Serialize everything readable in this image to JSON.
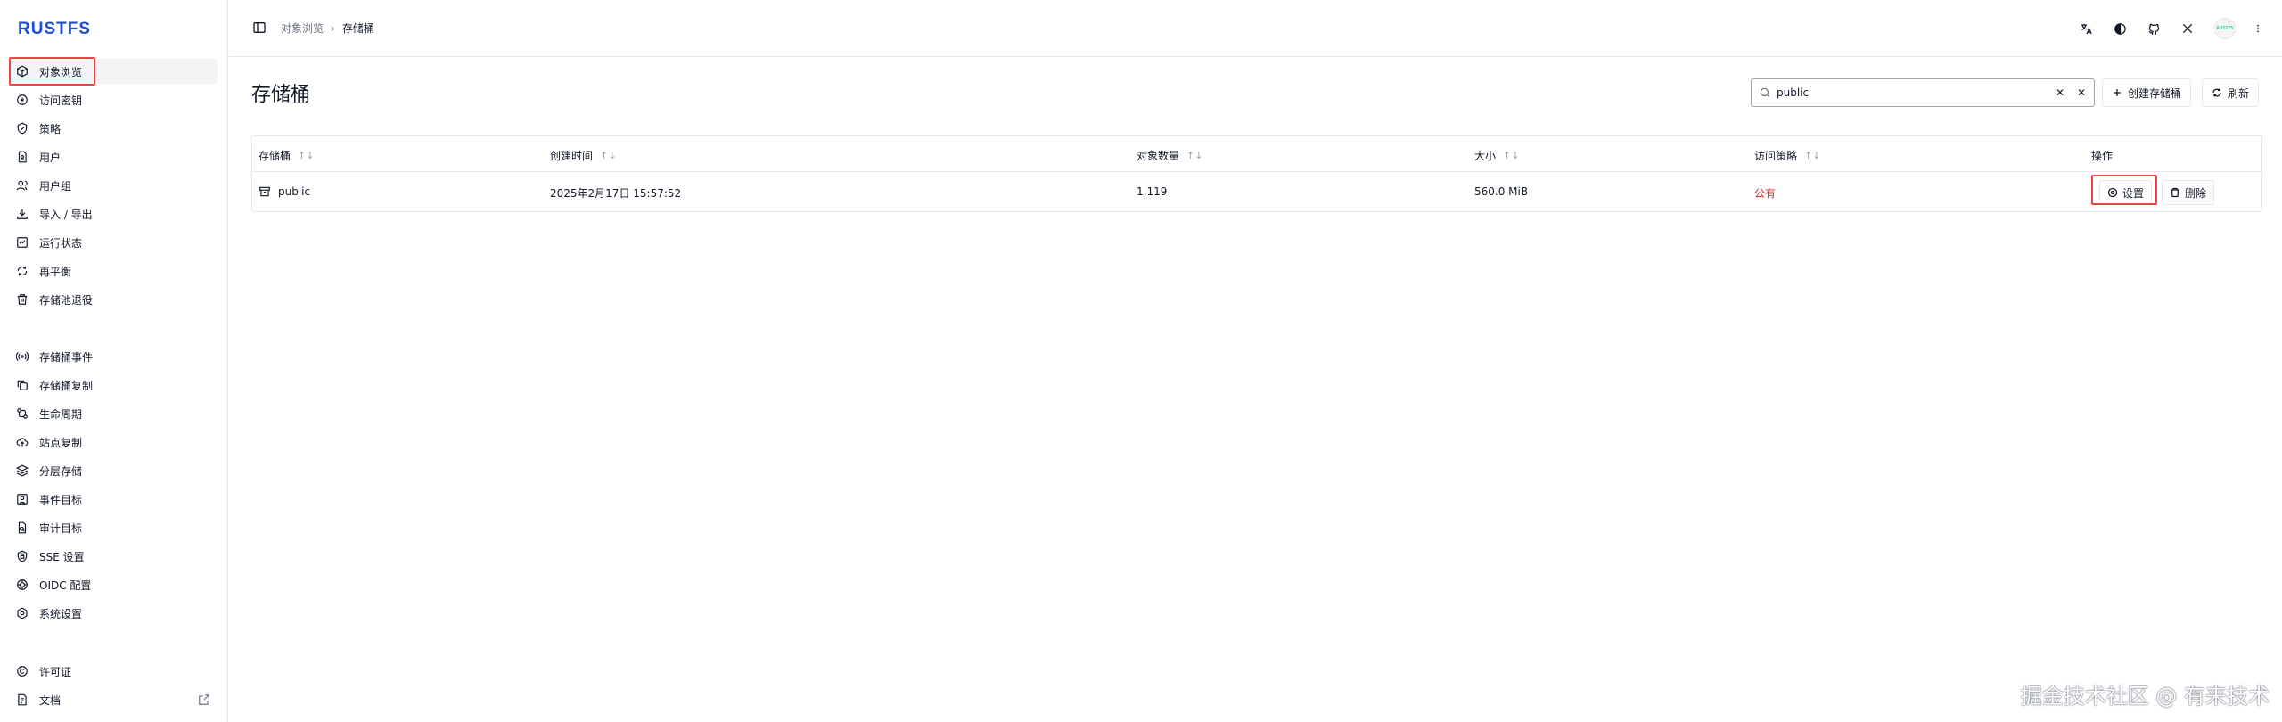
{
  "app": {
    "logo": "RUSTFS"
  },
  "sidebar": {
    "items": [
      {
        "label": "对象浏览",
        "icon": "box-icon"
      },
      {
        "label": "访问密钥",
        "icon": "key-icon"
      },
      {
        "label": "策略",
        "icon": "shield-icon"
      },
      {
        "label": "用户",
        "icon": "user-icon"
      },
      {
        "label": "用户组",
        "icon": "users-icon"
      },
      {
        "label": "导入 / 导出",
        "icon": "download-icon"
      },
      {
        "label": "运行状态",
        "icon": "activity-icon"
      },
      {
        "label": "再平衡",
        "icon": "refresh-icon"
      },
      {
        "label": "存储池退役",
        "icon": "trash-icon"
      },
      {
        "label": "存储桶事件",
        "icon": "radio-icon"
      },
      {
        "label": "存储桶复制",
        "icon": "copy-icon"
      },
      {
        "label": "生命周期",
        "icon": "cycle-icon"
      },
      {
        "label": "站点复制",
        "icon": "cloud-upload-icon"
      },
      {
        "label": "分层存储",
        "icon": "layers-icon"
      },
      {
        "label": "事件目标",
        "icon": "target-icon"
      },
      {
        "label": "审计目标",
        "icon": "file-search-icon"
      },
      {
        "label": "SSE 设置",
        "icon": "lock-icon"
      },
      {
        "label": "OIDC 配置",
        "icon": "aperture-icon"
      },
      {
        "label": "系统设置",
        "icon": "settings-icon"
      },
      {
        "label": "许可证",
        "icon": "copyright-icon"
      },
      {
        "label": "文档",
        "icon": "doc-icon"
      }
    ]
  },
  "header": {
    "breadcrumb": [
      "对象浏览",
      "存储桶"
    ],
    "avatar_text": "RUSTFS"
  },
  "main": {
    "title": "存储桶",
    "search": {
      "value": "public",
      "placeholder": ""
    },
    "create_label": "创建存储桶",
    "refresh_label": "刷新",
    "columns": [
      "存储桶",
      "创建时间",
      "对象数量",
      "大小",
      "访问策略",
      "操作"
    ],
    "rows": [
      {
        "name": "public",
        "created": "2025年2月17日 15:57:52",
        "objects": "1,119",
        "size": "560.0 MiB",
        "policy": "公有",
        "settings_label": "设置",
        "delete_label": "删除"
      }
    ]
  },
  "watermark": "掘金技术社区 @ 有来技术"
}
